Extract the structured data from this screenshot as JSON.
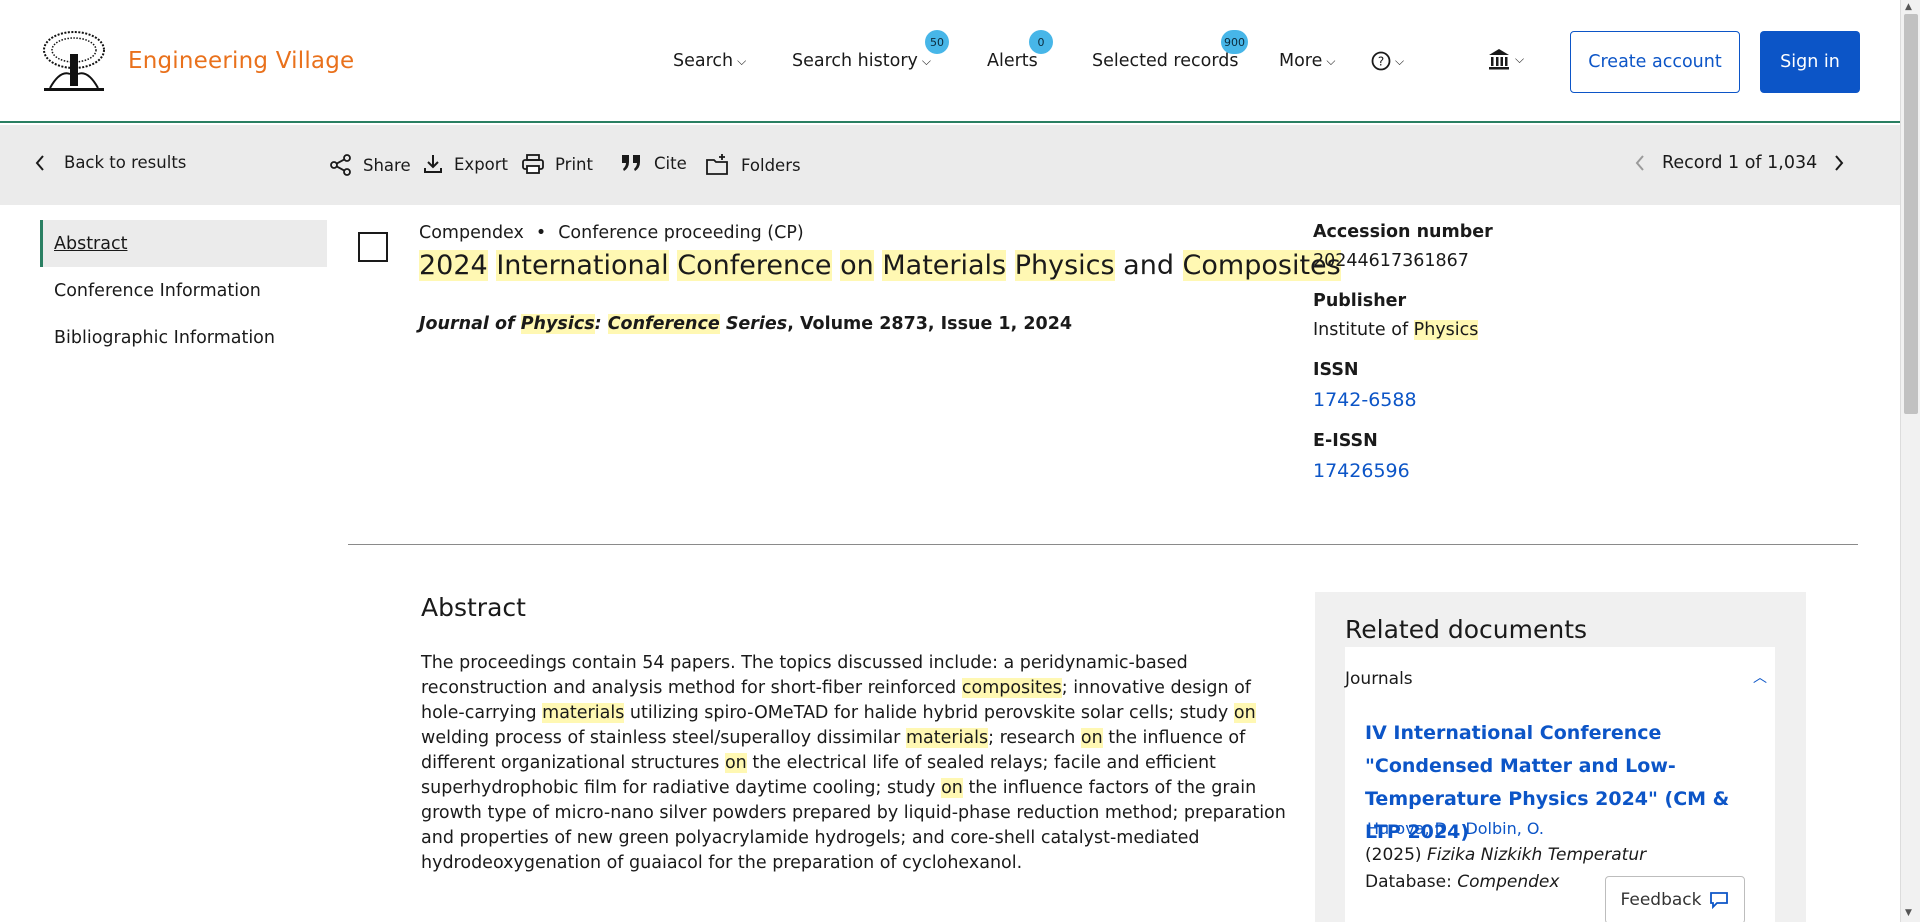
{
  "header": {
    "brand": "Engineering Village",
    "nav": {
      "search": "Search",
      "search_history": "Search history",
      "search_history_badge": "50",
      "alerts": "Alerts",
      "alerts_badge": "0",
      "selected_records": "Selected records",
      "selected_records_badge": "900",
      "more": "More"
    },
    "create_account": "Create account",
    "sign_in": "Sign in"
  },
  "toolbar": {
    "back": "Back to results",
    "share": "Share",
    "export": "Export",
    "print": "Print",
    "cite": "Cite",
    "folders": "Folders",
    "record_position": "Record 1 of 1,034"
  },
  "sidenav": {
    "items": [
      "Abstract",
      "Conference Information",
      "Bibliographic Information"
    ]
  },
  "record": {
    "database": "Compendex",
    "separator": "•",
    "doc_type": "Conference proceeding (CP)",
    "title_parts": [
      "2024",
      " ",
      "International",
      " ",
      "Conference",
      " ",
      "on",
      " ",
      "Materials",
      " ",
      "Physics",
      " and ",
      "Composites"
    ],
    "journal": {
      "part1": "Journal of ",
      "part2": "Physics",
      "part3": ": ",
      "part4": "Conference",
      "part5": " Series",
      "rest": ", Volume 2873, Issue 1, 2024"
    }
  },
  "details": {
    "accession_label": "Accession number",
    "accession_value": "20244617361867",
    "publisher_label": "Publisher",
    "publisher_pre": "Institute of ",
    "publisher_hl": "Physics",
    "issn_label": "ISSN",
    "issn_value": "1742-6588",
    "eissn_label": "E-ISSN",
    "eissn_value": "17426596"
  },
  "abstract": {
    "heading": "Abstract",
    "segments": [
      {
        "t": "The proceedings contain 54 papers. The topics discussed include: a peridynamic-based reconstruction and analysis method for short-fiber reinforced ",
        "h": false
      },
      {
        "t": "composites",
        "h": true
      },
      {
        "t": "; innovative design of hole-carrying ",
        "h": false
      },
      {
        "t": "materials",
        "h": true
      },
      {
        "t": " utilizing spiro-OMeTAD for halide hybrid perovskite solar cells; study ",
        "h": false
      },
      {
        "t": "on",
        "h": true
      },
      {
        "t": " welding process of stainless steel/superalloy dissimilar ",
        "h": false
      },
      {
        "t": "materials",
        "h": true
      },
      {
        "t": "; research ",
        "h": false
      },
      {
        "t": "on",
        "h": true
      },
      {
        "t": " the influence of different organizational structures ",
        "h": false
      },
      {
        "t": "on",
        "h": true
      },
      {
        "t": " the electrical life of sealed relays; facile and efficient superhydrophobic film for radiative daytime cooling; study ",
        "h": false
      },
      {
        "t": "on",
        "h": true
      },
      {
        "t": " the influence factors of the grain growth type of micro-nano silver powders prepared by liquid-phase reduction method; preparation and properties of new green polyacrylamide hydrogels; and core-shell catalyst-mediated hydrodeoxygenation of guaiacol for the preparation of cyclohexanol.",
        "h": false
      }
    ]
  },
  "related": {
    "title": "Related documents",
    "tab": "Journals",
    "doc_title": "IV International Conference \"Condensed Matter and Low-Temperature Physics 2024\" (CM & LTP 2024)",
    "author1": "Hurova, D.;",
    "author2": "Dolbin, O.",
    "source_year": "(2025) ",
    "source_journal": "Fizika Nizkikh Temperatur",
    "db_label": "Database: ",
    "db_value": "Compendex"
  },
  "feedback": "Feedback"
}
